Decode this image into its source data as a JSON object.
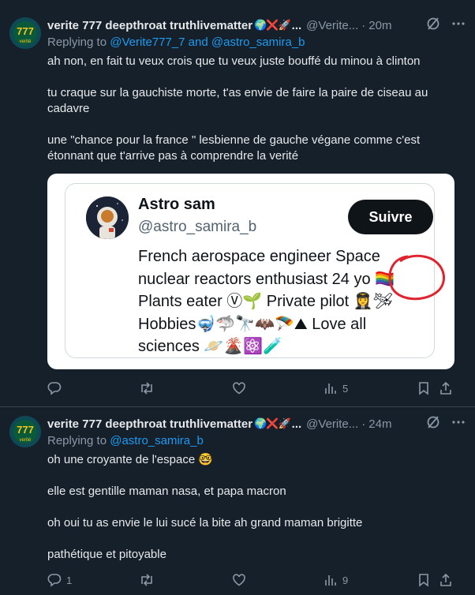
{
  "tweets": [
    {
      "display_name": "verite 777 deepthroat truthlivematter",
      "name_emojis": "🌍❌🚀",
      "name_ellipsis": "...",
      "handle": "@Verite...",
      "dot": "·",
      "time": "20m",
      "replying_prefix": "Replying to ",
      "replying_to_1": "@Verite777_7",
      "replying_and": " and ",
      "replying_to_2": "@astro_samira_b",
      "paragraphs": [
        "ah non, en fait tu veux crois que tu veux juste bouffé du minou à clinton",
        "tu craque sur la gauchiste morte, t'as envie de faire la paire de ciseau au cadavre",
        "une \"chance pour la france \" lesbienne de gauche végane comme c'est étonnant que t'arrive pas à comprendre la verité"
      ],
      "embedded_card": {
        "name": "Astro sam",
        "handle": "@astro_samira_b",
        "follow_label": "Suivre",
        "bio_lines": [
          "French aerospace engineer Space",
          "nuclear reactors enthusiast 24 yo 🏳️‍🌈",
          "Plants eater Ⓥ🌱 Private pilot 👩‍✈️🛩",
          "Hobbies🤿🦈🔭🦇🪂⛰ Love all",
          "sciences 🪐🌋⚛️🧪"
        ]
      },
      "stats": {
        "replies": "",
        "reposts": "",
        "likes": "",
        "views": "5"
      }
    },
    {
      "display_name": "verite 777 deepthroat truthlivematter",
      "name_emojis": "🌍❌🚀",
      "name_ellipsis": "...",
      "handle": "@Verite...",
      "dot": "·",
      "time": "24m",
      "replying_prefix": "Replying to ",
      "replying_to_1": "@astro_samira_b",
      "paragraphs": [
        "oh une croyante de l'espace 🤓",
        "elle est gentille maman nasa, et papa macron",
        "oh oui tu as envie le lui sucé la bite ah grand maman brigitte",
        "pathétique et pitoyable"
      ],
      "stats": {
        "replies": "1",
        "reposts": "",
        "likes": "",
        "views": "9"
      }
    }
  ],
  "colors": {
    "background": "#15202b",
    "text": "#e7e9ea",
    "muted": "#8b98a5",
    "link": "#1d9bf0",
    "annotation": "#e0242f"
  },
  "icons": [
    "grok-icon",
    "more-icon",
    "reply-icon",
    "repost-icon",
    "like-icon",
    "views-icon",
    "bookmark-icon",
    "share-icon"
  ]
}
